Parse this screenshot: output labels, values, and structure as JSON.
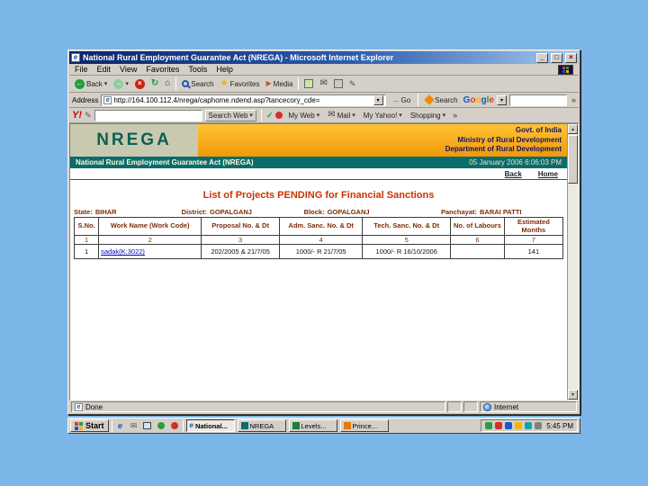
{
  "icons": {
    "ie": "e",
    "minimize": "_",
    "maximize": "□",
    "close": "×",
    "back": "←",
    "forward": "→",
    "stop": "×",
    "refresh": "↻",
    "home": "⌂",
    "favorites": "★",
    "media": "▶",
    "mail": "✉",
    "edit_pencil": "✎",
    "dropdown": "▾",
    "chevrons": "»",
    "go": "→",
    "check": "✓",
    "up_arrow": "▲",
    "down_arrow": "▼"
  },
  "window": {
    "title": "National Rural Employment Guarantee Act (NREGA) - Microsoft Internet Explorer",
    "menu": [
      "File",
      "Edit",
      "View",
      "Favorites",
      "Tools",
      "Help"
    ],
    "toolbar": {
      "back_label": "Back",
      "search_label": "Search",
      "favorites_label": "Favorites",
      "media_label": "Media"
    },
    "address": {
      "label": "Address",
      "url": "http://164.100.112.4/nrega/caphome.ndend.asp?tancecory_cde=",
      "go_label": "Go",
      "search_label": "Search",
      "google_letters": [
        "G",
        "o",
        "o",
        "g",
        "l",
        "e"
      ]
    },
    "yahoo": {
      "logo": "Y!",
      "search_web_label": "Search Web",
      "my_web_label": "My Web",
      "mail_label": "Mail",
      "my_yahoo_label": "My Yahoo!",
      "shopping_label": "Shopping"
    },
    "status": {
      "done": "Done",
      "zone": "Internet"
    }
  },
  "page": {
    "logo_text": "NREGA",
    "govt_lines": [
      "Govt. of India",
      "Ministry of Rural Development",
      "Department of Rural Development"
    ],
    "banner_title": "National Rural Employment Guarantee Act (NREGA)",
    "banner_datetime": "05 January 2006  6:06:03 PM",
    "back_link": "Back",
    "home_link": "Home",
    "content_title": "List of Projects PENDING for Financial Sanctions",
    "filters": [
      {
        "label": "State:",
        "value": "BIHAR"
      },
      {
        "label": "District:",
        "value": "GOPALGANJ"
      },
      {
        "label": "Block:",
        "value": "GOPALGANJ"
      },
      {
        "label": "Panchayat:",
        "value": "BARAI PATTI"
      }
    ],
    "table": {
      "headers": [
        "S.No.",
        "Work Name (Work Code)",
        "Proposal No. & Dt",
        "Adm. Sanc. No. & Dt",
        "Tech. Sanc. No. & Dt",
        "No. of Labours",
        "Estimated Months"
      ],
      "col_numbers": [
        "1",
        "2",
        "3",
        "4",
        "5",
        "6",
        "7"
      ],
      "row": {
        "sno": "1",
        "work": "sadak(K:3022)",
        "proposal": "202/2005 & 21/7/05",
        "adm": "1000/- R 21/7/05",
        "tech": "1000/- R 16/10/2006",
        "labours": "",
        "months": "141"
      }
    }
  },
  "taskbar": {
    "start_label": "Start",
    "tasks": [
      {
        "label": "National..."
      },
      {
        "label": "NREGA"
      },
      {
        "label": "Levels..."
      },
      {
        "label": "Prince..."
      }
    ],
    "clock": "5:45 PM"
  }
}
